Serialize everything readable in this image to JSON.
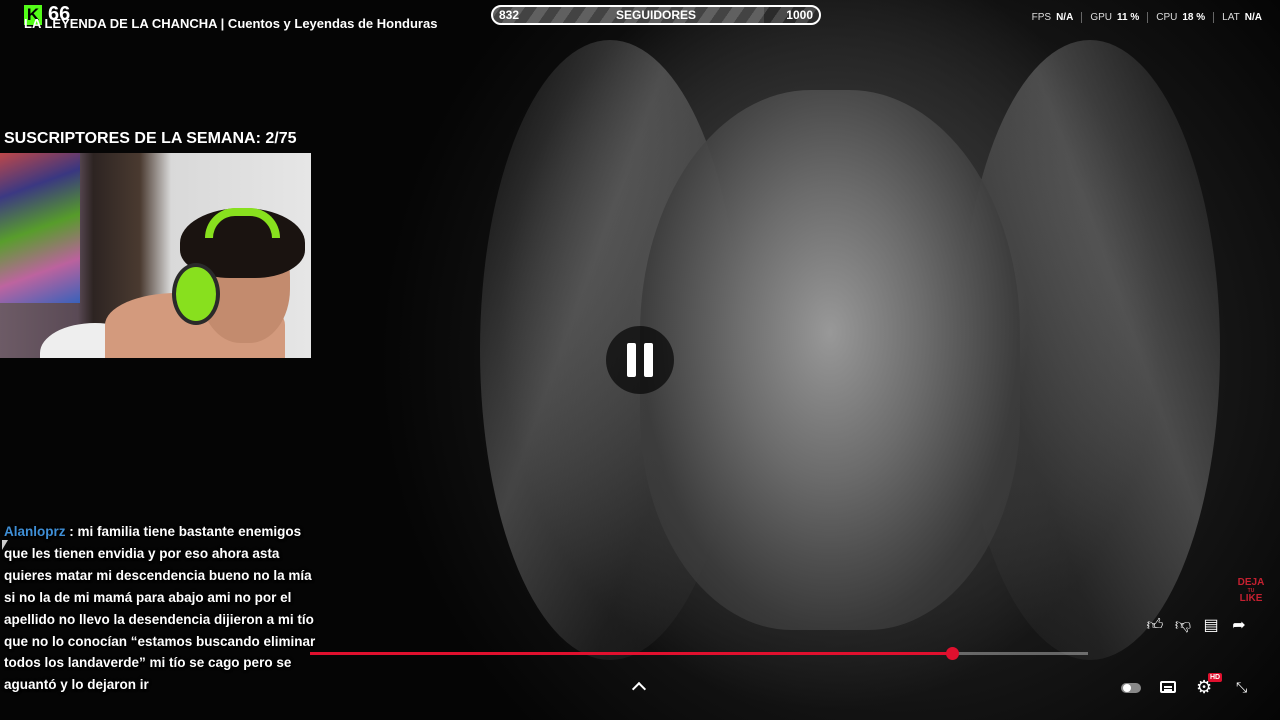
{
  "stream": {
    "viewer_count": "66",
    "title": "LA LEYENDA DE LA CHANCHA | Cuentos y Leyendas de Honduras"
  },
  "follower_goal": {
    "current": "832",
    "label": "SEGUIDORES",
    "target": "1000",
    "progress": 0.832
  },
  "stats": [
    {
      "key": "FPS",
      "value": "N/A"
    },
    {
      "key": "GPU",
      "value": "11 %"
    },
    {
      "key": "CPU",
      "value": "18 %"
    },
    {
      "key": "LAT",
      "value": "N/A"
    }
  ],
  "subs": {
    "heading": "SUSCRIPTORES DE LA SEMANA: 2/75"
  },
  "chat": {
    "username": "Alanloprz",
    "separator": " : ",
    "message": "mi familia tiene bastante enemigos que les tienen envidia y por eso ahora asta quieres matar mi descendencia bueno no la mía si no la de mi mamá para abajo ami no por el apellido no llevo la desendencia dijieron a mi tío que no lo conocían “estamos buscando eliminar todos los landaverde” mi tío se cago pero se aguantó y lo dejaron ir"
  },
  "player": {
    "progress_fraction": 0.825,
    "hd_badge": "HD",
    "accent_color": "#e0102e"
  },
  "watermark": {
    "line1": "DEJA",
    "line2": "TU",
    "line3": "LIKE"
  },
  "icons": {
    "pause": "pause-icon",
    "like": "thumbs-up-icon",
    "dislike": "thumbs-down-icon",
    "comment": "comment-icon",
    "share": "share-icon",
    "settings": "gear-icon",
    "captions": "captions-icon",
    "fullscreen_exit": "fullscreen-exit-icon"
  }
}
